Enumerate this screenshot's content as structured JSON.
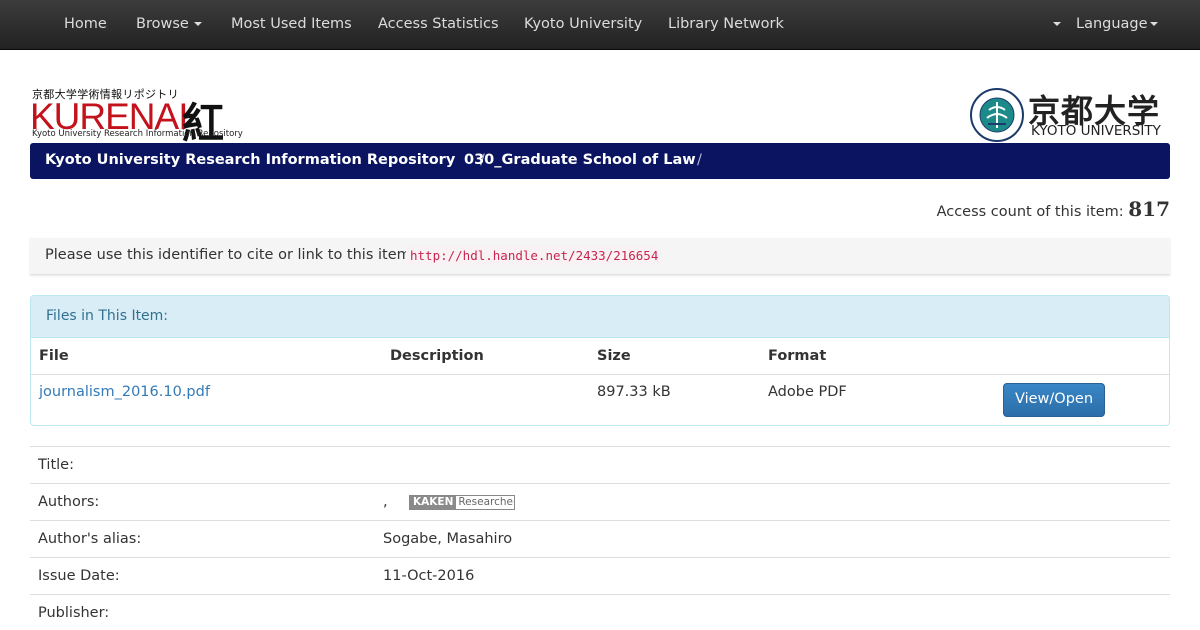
{
  "navbar": {
    "home": "Home",
    "browse": "Browse",
    "most_used": "Most Used Items",
    "access_stats": "Access Statistics",
    "kyoto_univ": "Kyoto University",
    "library_network": "Library Network",
    "language": "Language"
  },
  "logos": {
    "kurenai_jp": "京都大学学術情報リポジトリ",
    "kurenai_big": "KURENAI",
    "kurenai_kanji": "紅",
    "kurenai_sub": "Kyoto University Research Information Repository",
    "kyoto_jp": "京都大学",
    "kyoto_en": "KYOTO UNIVERSITY"
  },
  "breadcrumb": {
    "items": [
      "Kyoto University Research Information Repository",
      "030_Graduate School of Law"
    ],
    "separator": "/"
  },
  "access": {
    "label": "Access count of this item:",
    "count": "817"
  },
  "cite": {
    "label": "Please use this identifier to cite or link to this item:",
    "url": "http://hdl.handle.net/2433/216654"
  },
  "files": {
    "heading": "Files in This Item:",
    "columns": [
      "File",
      "Description",
      "Size",
      "Format"
    ],
    "rows": [
      {
        "file": "journalism_2016.10.pdf",
        "description": "",
        "size": "897.33 kB",
        "format": "Adobe PDF",
        "action": "View/Open"
      }
    ]
  },
  "metadata": [
    {
      "key": "Title:",
      "value": ""
    },
    {
      "key": "Authors:",
      "value": ",",
      "badge_a": "KAKEN",
      "badge_b": "Researcher"
    },
    {
      "key": "Author's alias:",
      "value": "Sogabe, Masahiro"
    },
    {
      "key": "Issue Date:",
      "value": "11-Oct-2016"
    },
    {
      "key": "Publisher:",
      "value": ""
    }
  ],
  "colors": {
    "breadcrumb_bg": "#0b1461",
    "kurenai_red": "#c3121b",
    "link": "#337ab7",
    "panel_head": "#d9edf7",
    "code": "#c7254e"
  }
}
